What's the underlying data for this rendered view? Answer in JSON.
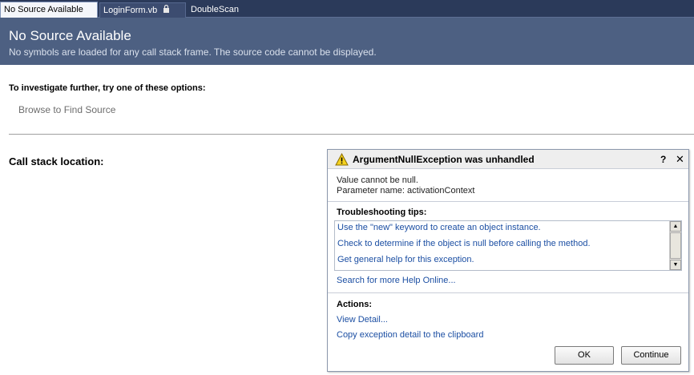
{
  "tabs": [
    {
      "label": "No Source Available"
    },
    {
      "label": "LoginForm.vb"
    },
    {
      "label": "DoubleScan"
    }
  ],
  "banner": {
    "title": "No Source Available",
    "subtitle": "No symbols are loaded for any call stack frame. The source code cannot be displayed."
  },
  "body": {
    "investigate_label": "To investigate further, try one of these options:",
    "browse_label": "Browse to Find Source",
    "call_stack_label": "Call stack location:"
  },
  "exception": {
    "title": "ArgumentNullException was unhandled",
    "help_label": "?",
    "close_label": "✕",
    "message_line1": "Value cannot be null.",
    "message_line2": "Parameter name: activationContext",
    "tips_title": "Troubleshooting tips:",
    "tips": [
      "Use the \"new\" keyword to create an object instance.",
      "Check to determine if the object is null before calling the method.",
      "Get general help for this exception."
    ],
    "search_link": "Search for more Help Online...",
    "actions_title": "Actions:",
    "actions": [
      "View Detail...",
      "Copy exception detail to the clipboard"
    ],
    "ok_label": "OK",
    "continue_label": "Continue"
  },
  "colors": {
    "banner_bg": "#4d6082",
    "link": "#1c4fa3",
    "tab_strip": "#2b3a5a"
  }
}
